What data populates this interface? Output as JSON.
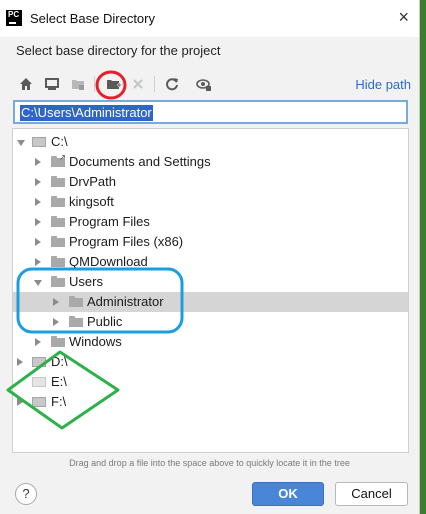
{
  "window": {
    "app_icon_text": "PC",
    "title": "Select Base Directory"
  },
  "subtitle": "Select base directory for the project",
  "toolbar": {
    "buttons": [
      {
        "name": "home-icon"
      },
      {
        "name": "desktop-icon"
      },
      {
        "name": "project-folder-icon"
      },
      {
        "name": "new-folder-icon"
      },
      {
        "name": "delete-icon"
      },
      {
        "name": "refresh-icon"
      },
      {
        "name": "show-hidden-icon"
      }
    ],
    "hide_path_label": "Hide path"
  },
  "path_field": {
    "value": "C:\\Users\\Administrator"
  },
  "tree": {
    "c_drive": "C:\\",
    "c_children": [
      "Documents and Settings",
      "DrvPath",
      "kingsoft",
      "Program Files",
      "Program Files (x86)",
      "QMDownload",
      "Users"
    ],
    "users_children": [
      "Administrator",
      "Public"
    ],
    "windows": "Windows",
    "drives": [
      "D:\\",
      "E:\\",
      "F:\\"
    ]
  },
  "hint": "Drag and drop a file into the space above to quickly locate it in the tree",
  "help_label": "?",
  "ok_label": "OK",
  "cancel_label": "Cancel",
  "colors": {
    "annotation_red": "#e5202a",
    "annotation_blue": "#1a9ee0",
    "annotation_green": "#2eb14a",
    "accent": "#4a86d7"
  }
}
